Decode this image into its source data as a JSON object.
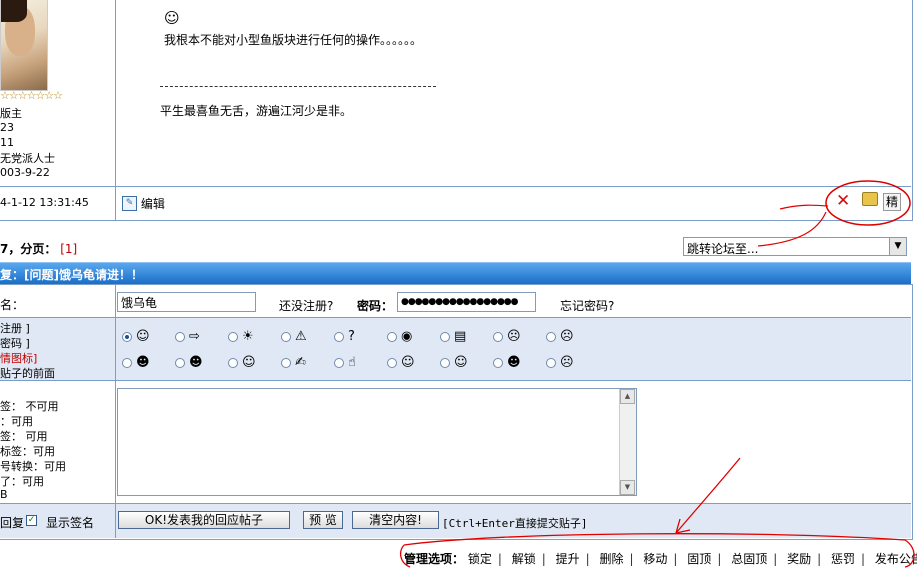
{
  "post": {
    "user_stars": "☆☆☆☆☆☆☆",
    "user_lines": [
      "版主",
      "23",
      "11",
      "无党派人士",
      "003-9-22"
    ],
    "time": "4-1-12 13:31:45",
    "body_line": "我根本不能对小型鱼版块进行任何的操作。。。。。。",
    "separator": "----------------------------------------------------",
    "signature": "平生最喜鱼无舌，游遍江河少是非。",
    "edit_label": "编辑",
    "elite_label": "精"
  },
  "pagination": {
    "prefix": "7，分页：",
    "current": "[1]"
  },
  "jump": {
    "placeholder": "跳转论坛至..."
  },
  "reply_header": "复：[问题]饿乌龟请进！！",
  "form": {
    "name_label": "名：",
    "username_value": "饿乌龟",
    "register_link": "还没注册?",
    "password_label": "密码：",
    "password_value": "●●●●●●●●●●●●●●●●●",
    "forgot_link": "忘记密码?",
    "left_icon_lines": [
      "注册 ]",
      "密码 ]",
      "情图标]",
      "贴子的前面"
    ],
    "rules_lines": [
      "签：  不可用",
      "：可用",
      "签：  可用",
      "标签：可用",
      "号转换：可用",
      "了：可用",
      "B"
    ],
    "reply_opt": "回复",
    "show_signature": "显示签名",
    "submit_label": "OK!发表我的回应帖子",
    "preview_label": "预 览",
    "clear_label": "清空内容!",
    "hint": "[Ctrl+Enter直接提交贴子]"
  },
  "emoticons": [
    [
      "☺",
      "⇨",
      "☀",
      "⚠",
      "?",
      "◉",
      "▤",
      "☹",
      "☹"
    ],
    [
      "☻",
      "☻",
      "☺",
      "✍",
      "☝",
      "☺",
      "☺",
      "☻",
      "☹"
    ]
  ],
  "admin": {
    "label": "管理选项：",
    "items": [
      "锁定",
      "解锁",
      "提升",
      "删除",
      "移动",
      "固顶",
      "总固顶",
      "奖励",
      "惩罚",
      "发布公告"
    ]
  },
  "colors": {
    "accent": "#1a6ec8",
    "annotation": "#e00000",
    "border": "#7a9ec8"
  }
}
